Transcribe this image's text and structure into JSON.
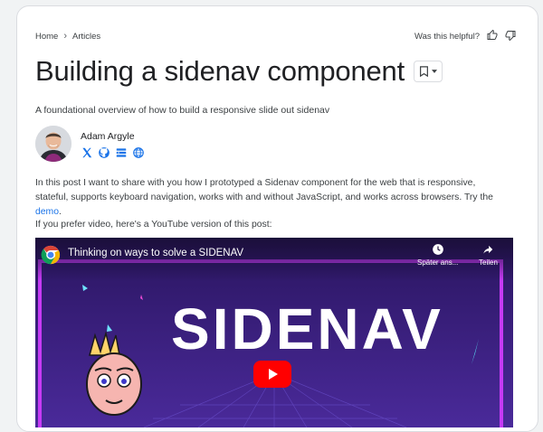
{
  "breadcrumb": {
    "home": "Home",
    "section": "Articles"
  },
  "helpful": {
    "question": "Was this helpful?"
  },
  "article": {
    "title": "Building a sidenav component",
    "subtitle": "A foundational overview of how to build a responsive slide out sidenav",
    "author": "Adam Argyle",
    "p1_before": "In this post I want to share with you how I prototyped a Sidenav component for the web that is responsive, stateful, supports keyboard navigation, works with and without JavaScript, and works across browsers. Try the ",
    "p1_link": "demo",
    "p1_after": ".",
    "p2": "If you prefer video, here's a YouTube version of this post:"
  },
  "video": {
    "title": "Thinking on ways to solve a SIDENAV",
    "later_label": "Später ans...",
    "share_label": "Teilen",
    "banner_text": "SIDENAV"
  },
  "colors": {
    "accent_link": "#1a73e8",
    "video_bg": "#3a1f78",
    "video_border": "#c63af5",
    "youtube_red": "#ff0000"
  },
  "icons": [
    "chevron-right-icon",
    "thumb-up-icon",
    "thumb-down-icon",
    "bookmark-icon",
    "caret-down-icon",
    "x-icon",
    "github-icon",
    "stack-icon",
    "globe-icon",
    "clock-icon",
    "share-icon",
    "play-icon"
  ]
}
